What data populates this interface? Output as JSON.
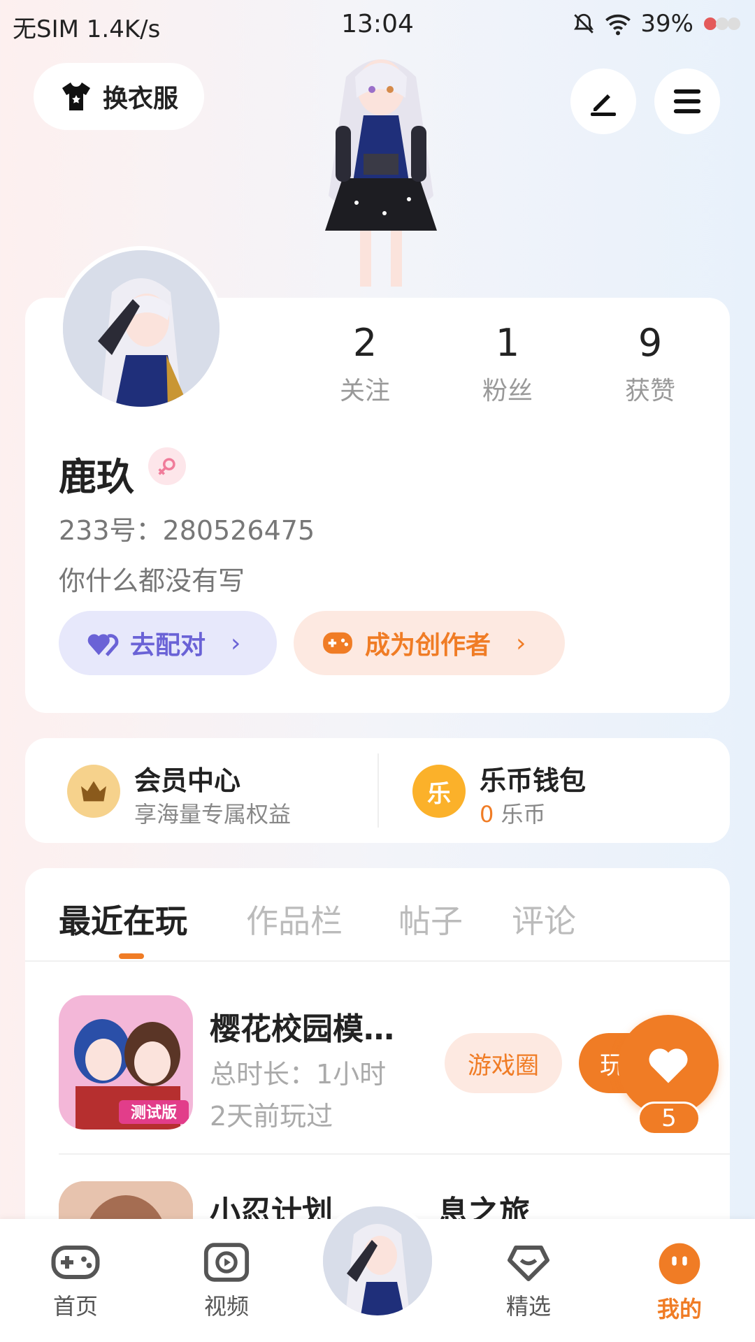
{
  "status_bar": {
    "left": "无SIM 1.4K/s",
    "time": "13:04",
    "battery": "39%"
  },
  "header": {
    "outfit_label": "换衣服"
  },
  "profile": {
    "stats": [
      {
        "value": "2",
        "label": "关注"
      },
      {
        "value": "1",
        "label": "粉丝"
      },
      {
        "value": "9",
        "label": "获赞"
      }
    ],
    "nickname": "鹿玖",
    "uid": "233号：280526475",
    "bio": "你什么都没有写",
    "match_label": "去配对",
    "creator_label": "成为创作者"
  },
  "wallet": {
    "member_title": "会员中心",
    "member_sub": "享海量专属权益",
    "coin_title": "乐币钱包",
    "coin_amount": "0",
    "coin_unit": "乐币",
    "coin_glyph": "乐"
  },
  "tabs": [
    "最近在玩",
    "作品栏",
    "帖子",
    "评论"
  ],
  "games": [
    {
      "title": "樱花校园模…",
      "duration": "总时长：1小时",
      "last_played": "2天前玩过",
      "circle_label": "游戏圈",
      "play_label": "玩",
      "icon_badge": "测试版"
    },
    {
      "title": "小忍计划",
      "title_suffix": "息之旅"
    }
  ],
  "float_like": {
    "count": "5"
  },
  "bottom_nav": [
    {
      "label": "首页"
    },
    {
      "label": "视频"
    },
    {
      "label": "精选"
    },
    {
      "label": "我的"
    }
  ],
  "colors": {
    "accent": "#f07c25",
    "match": "#6a62d6"
  }
}
